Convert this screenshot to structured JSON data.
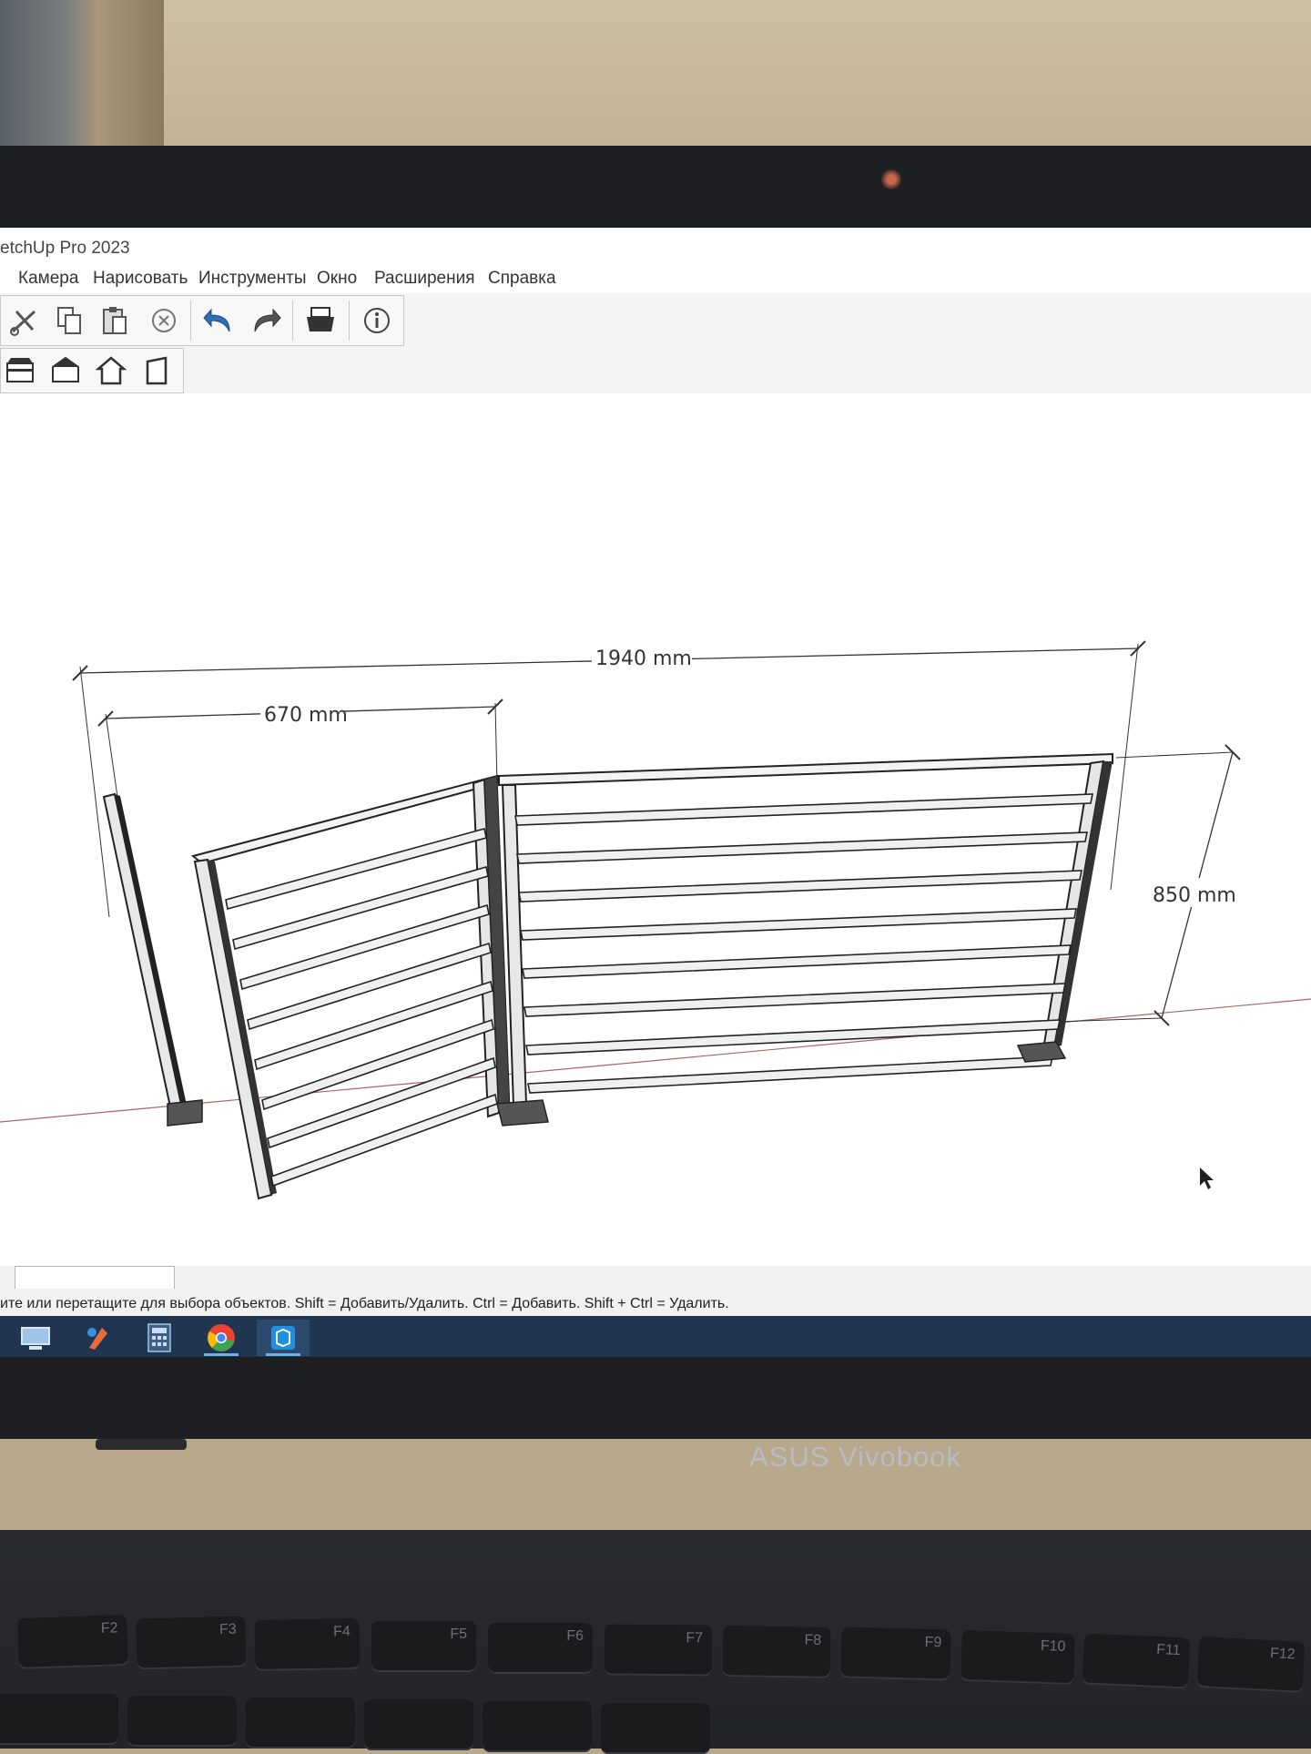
{
  "window": {
    "title": "etchUp Pro 2023"
  },
  "menu": {
    "items": [
      "Камера",
      "Нарисовать",
      "Инструменты",
      "Окно",
      "Расширения",
      "Справка"
    ]
  },
  "toolbar": {
    "standard": [
      "scissors-icon",
      "copy-icon",
      "paste-icon",
      "delete-icon",
      "undo-icon",
      "redo-icon",
      "print-icon",
      "model-info-icon"
    ],
    "views": [
      "top-view-icon",
      "front-view-icon",
      "right-view-icon",
      "back-view-icon"
    ]
  },
  "model": {
    "dimensions": {
      "overall_width": "1940 mm",
      "gate_width": "670 mm",
      "height": "850 mm"
    }
  },
  "measurements_box": {
    "value": ""
  },
  "status": {
    "text": "ите или перетащите для выбора объектов. Shift = Добавить/Удалить. Ctrl = Добавить. Shift + Ctrl = Удалить."
  },
  "taskbar": {
    "apps": [
      "file-explorer-icon",
      "paint-app-icon",
      "calculator-icon",
      "chrome-icon",
      "sketchup-icon"
    ]
  },
  "device": {
    "brand": "ASUS Vivobook"
  },
  "keyboard": {
    "keys": [
      "F2",
      "F3",
      "F4",
      "F5",
      "F6",
      "F7",
      "F8",
      "F9",
      "F10",
      "F11",
      "F12"
    ]
  }
}
